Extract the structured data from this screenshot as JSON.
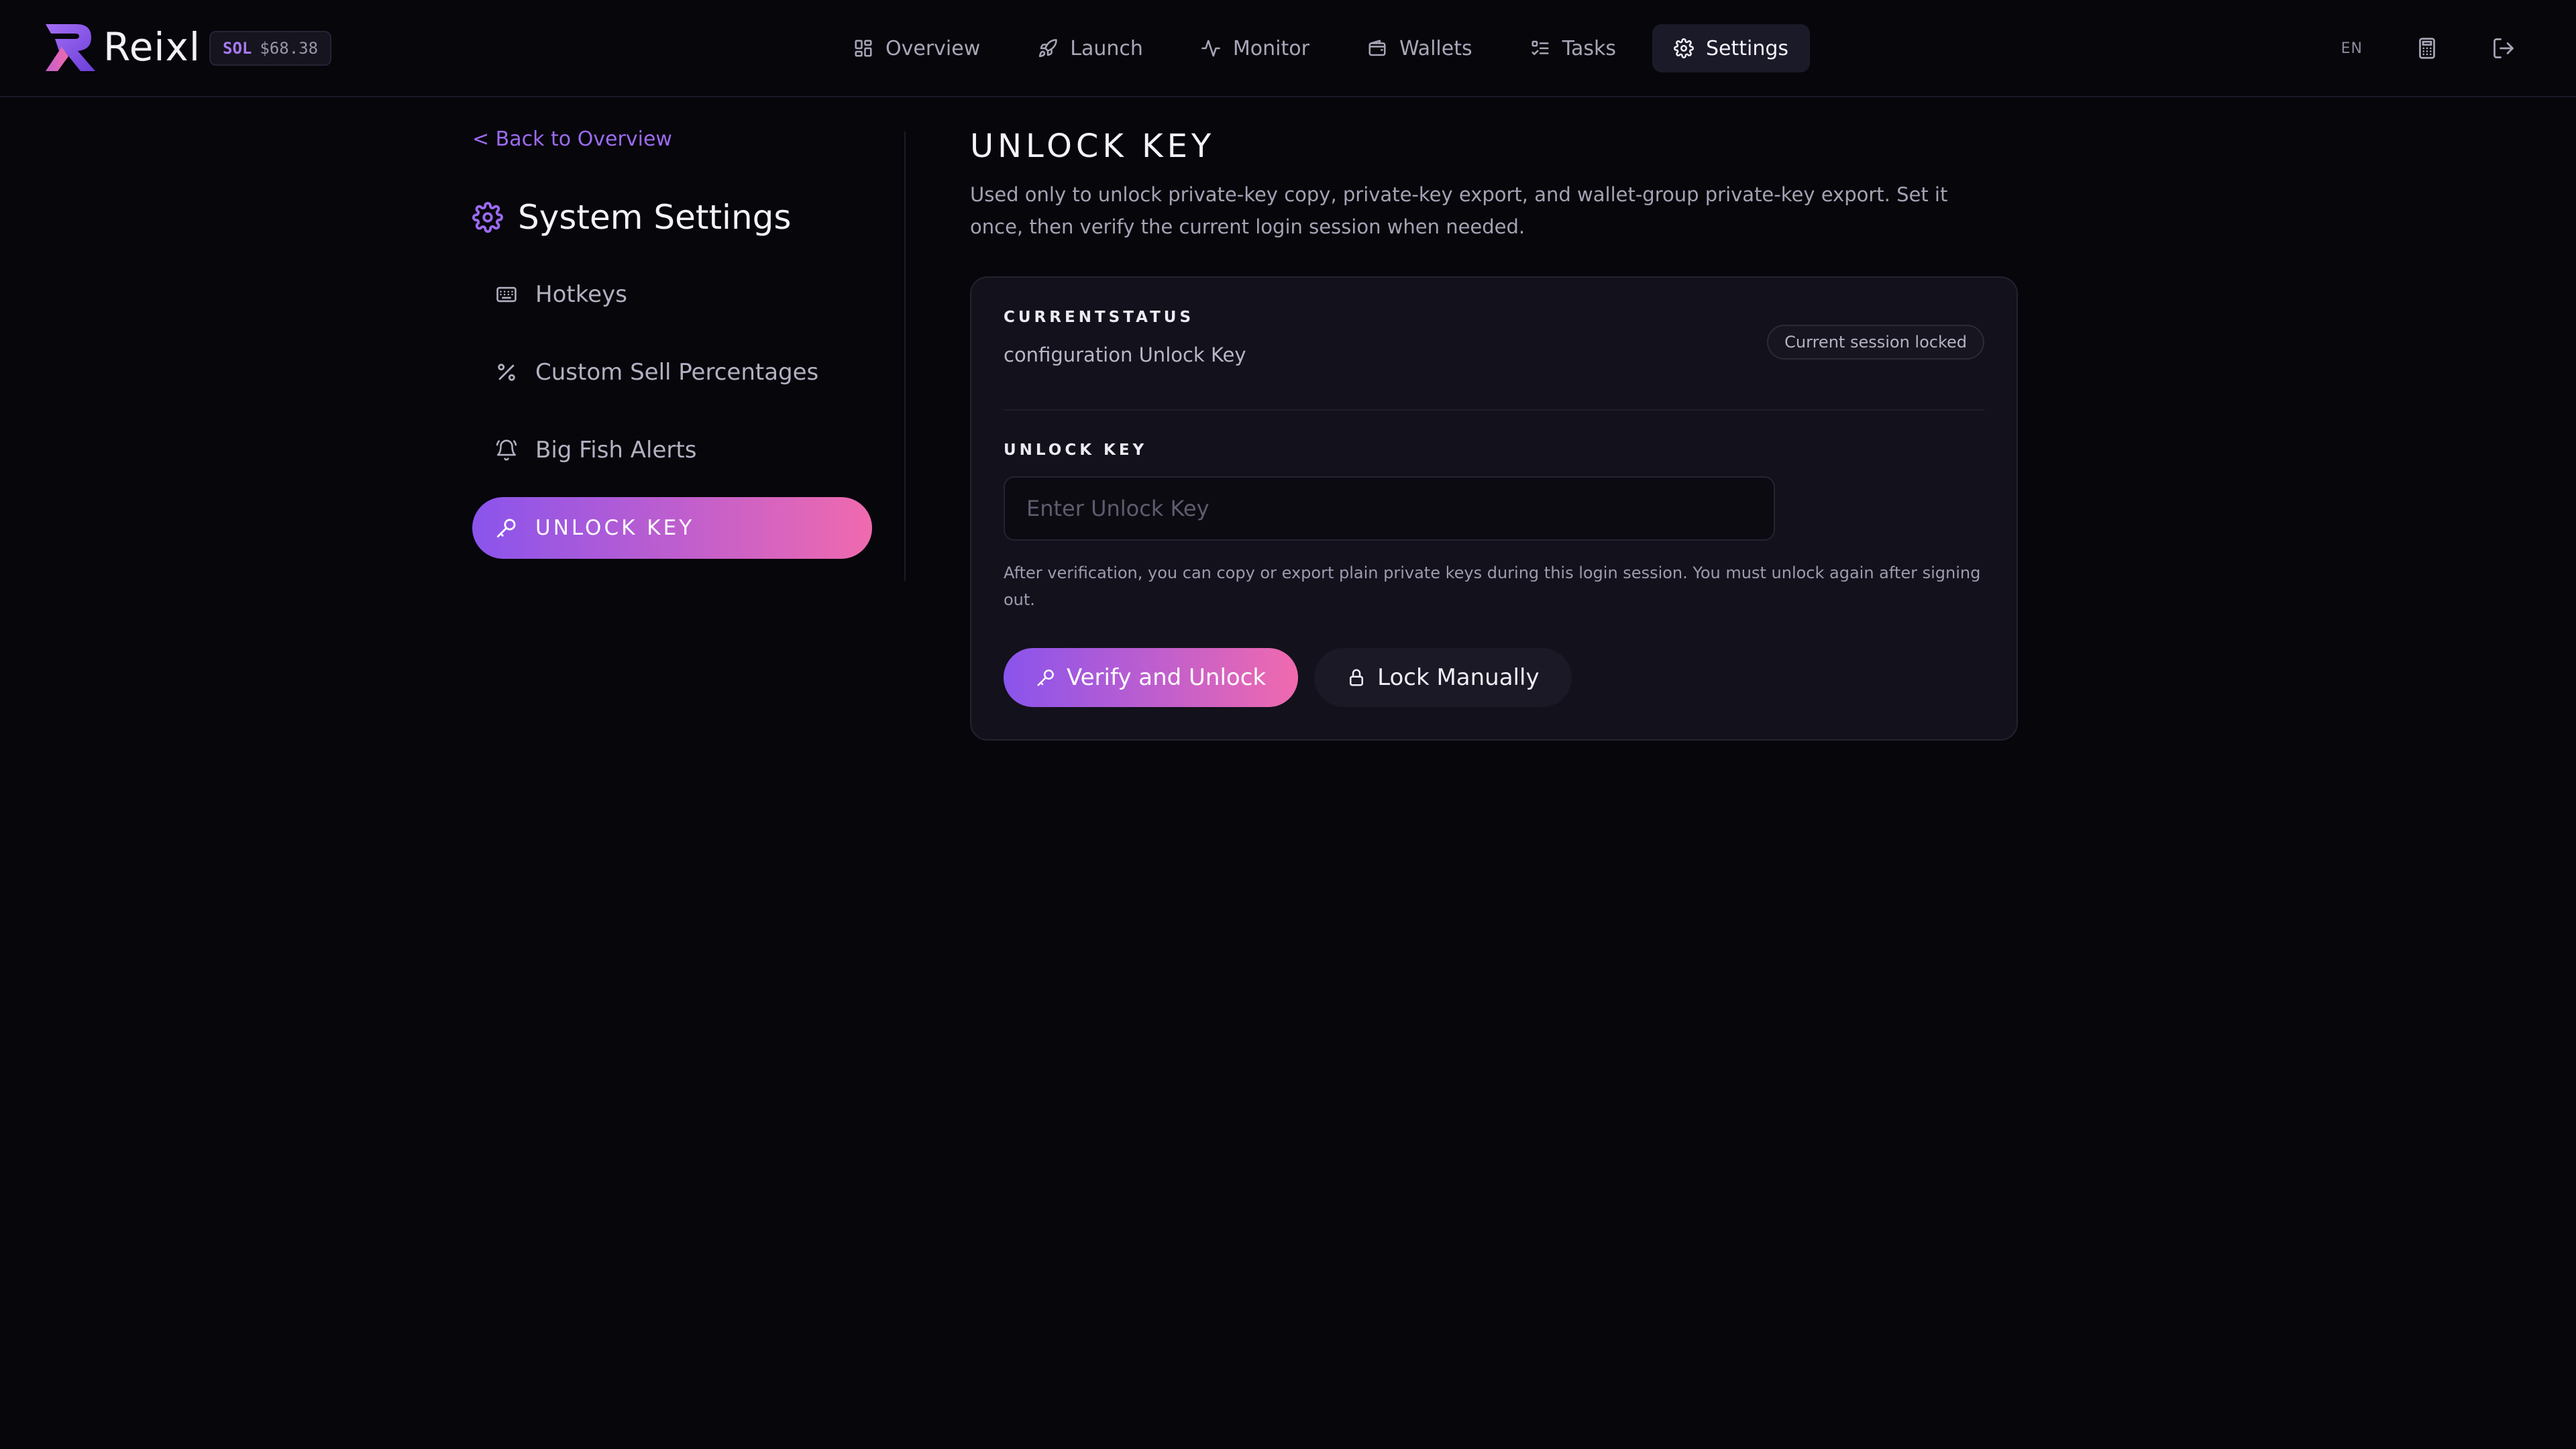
{
  "brand": {
    "name": "Reixl",
    "accent": "#8a54ec",
    "accent2": "#f06aae"
  },
  "ticker": {
    "symbol": "SOL",
    "price": "$68.38"
  },
  "nav": {
    "items": [
      {
        "label": "Overview",
        "icon": "grid-icon"
      },
      {
        "label": "Launch",
        "icon": "rocket-icon"
      },
      {
        "label": "Monitor",
        "icon": "activity-icon"
      },
      {
        "label": "Wallets",
        "icon": "wallet-icon"
      },
      {
        "label": "Tasks",
        "icon": "list-checks-icon"
      },
      {
        "label": "Settings",
        "icon": "gear-icon",
        "active": true
      }
    ]
  },
  "topbar_right": {
    "language": "EN",
    "icons": [
      "calculator-icon",
      "logout-icon"
    ]
  },
  "sidebar": {
    "back_label": "< Back to Overview",
    "title": "System Settings",
    "items": [
      {
        "label": "Hotkeys",
        "icon": "keyboard-icon"
      },
      {
        "label": "Custom Sell Percentages",
        "icon": "percent-icon"
      },
      {
        "label": "Big Fish Alerts",
        "icon": "bell-icon"
      },
      {
        "label": "UNLOCK KEY",
        "icon": "key-icon",
        "active": true
      }
    ]
  },
  "main": {
    "title": "UNLOCK KEY",
    "description": "Used only to unlock private-key copy, private-key export, and wallet-group private-key export. Set it once, then verify the current login session when needed.",
    "status": {
      "label": "CURRENTSTATUS",
      "value": "configuration Unlock Key",
      "badge": "Current session locked"
    },
    "unlock_key": {
      "label": "UNLOCK KEY",
      "placeholder": "Enter Unlock Key",
      "value": ""
    },
    "hint": "After verification, you can copy or export plain private keys during this login session. You must unlock again after signing out.",
    "buttons": {
      "verify": "Verify and Unlock",
      "lock": "Lock Manually"
    }
  }
}
